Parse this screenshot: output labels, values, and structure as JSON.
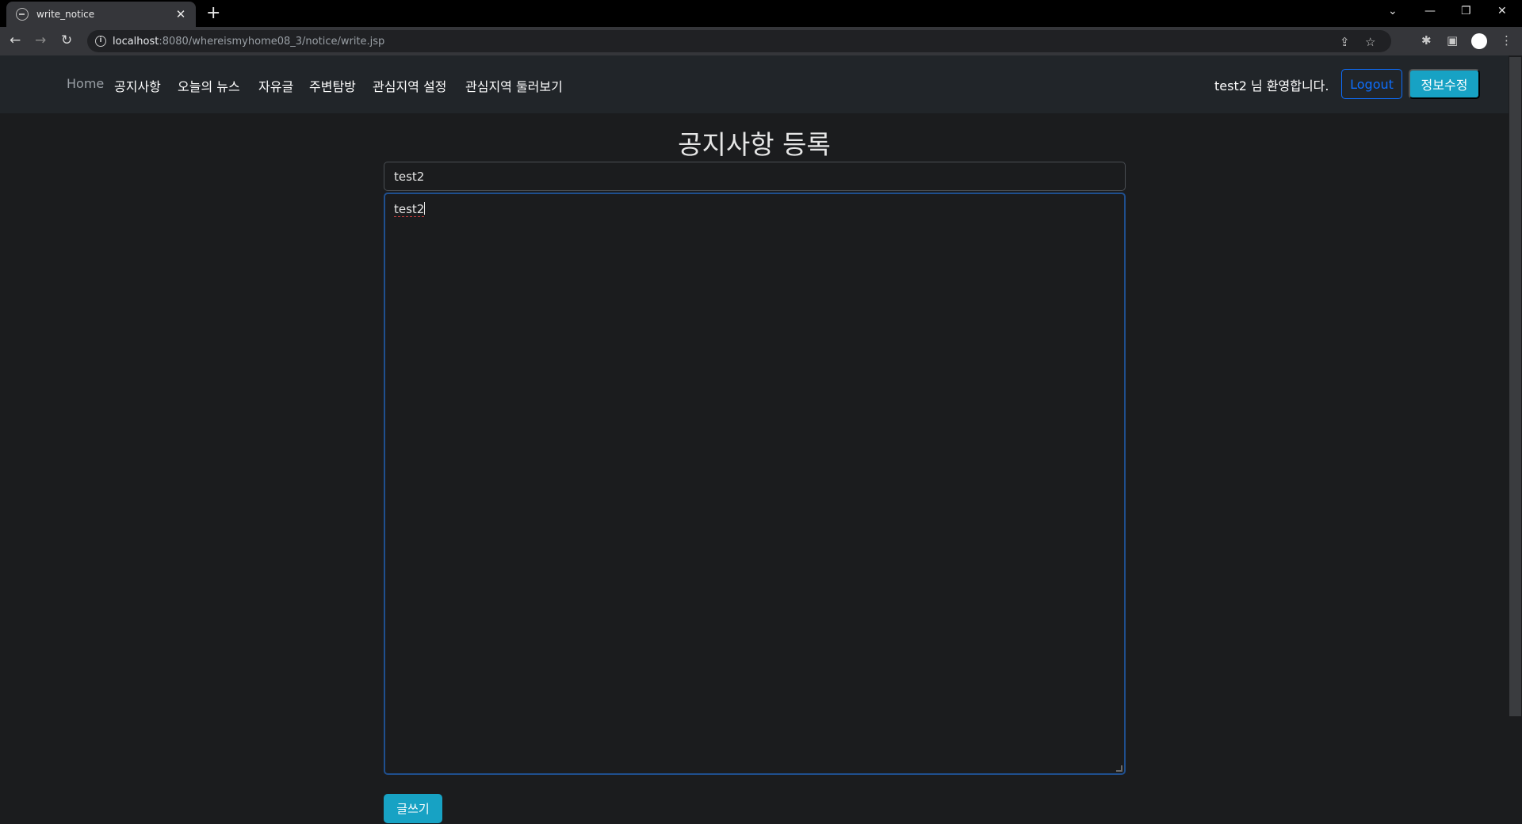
{
  "browser": {
    "tab_title": "write_notice",
    "tab_close_icon": "close-icon",
    "new_tab_label": "+",
    "url_host": "localhost",
    "url_rest": ":8080/whereismyhome08_3/notice/write.jsp"
  },
  "navbar": {
    "links": [
      "Home",
      "공지사항",
      "오늘의 뉴스",
      "자유글",
      "주변탐방",
      "관심지역 설정",
      "관심지역 둘러보기"
    ],
    "welcome": "test2 님 환영합니다.",
    "logout_label": "Logout",
    "edit_label": "정보수정"
  },
  "main": {
    "page_title": "공지사항 등록",
    "title_value": "test2",
    "content_value": "test2",
    "submit_label": "글쓰기"
  },
  "colors": {
    "background": "#1b1c1e",
    "navbar": "#212529",
    "primary_outline": "#0d6efd",
    "info": "#17a2c4"
  }
}
